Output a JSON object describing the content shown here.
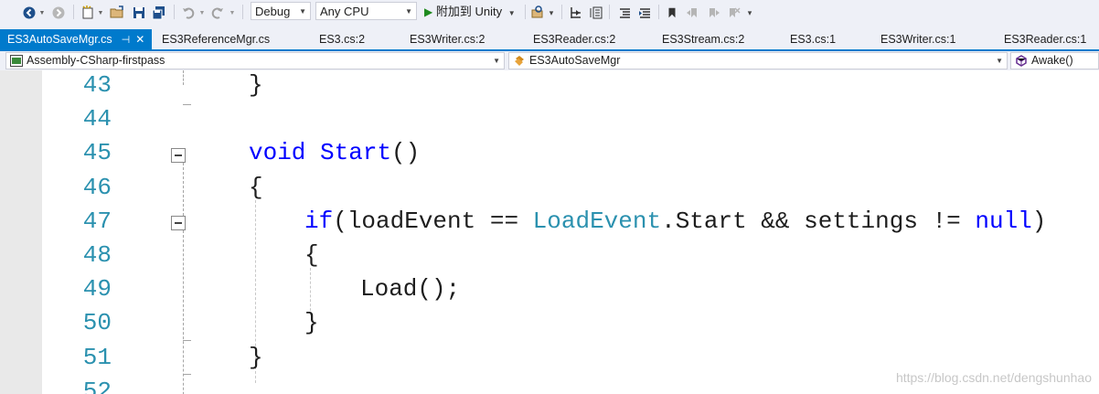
{
  "toolbar": {
    "config_label": "Debug",
    "platform_label": "Any CPU",
    "attach_label": "附加到 Unity"
  },
  "tabs": [
    {
      "label": "ES3AutoSaveMgr.cs",
      "active": true
    },
    {
      "label": "ES3ReferenceMgr.cs"
    },
    {
      "label": "ES3.cs:2"
    },
    {
      "label": "ES3Writer.cs:2"
    },
    {
      "label": "ES3Reader.cs:2"
    },
    {
      "label": "ES3Stream.cs:2"
    },
    {
      "label": "ES3.cs:1"
    },
    {
      "label": "ES3Writer.cs:1"
    },
    {
      "label": "ES3Reader.cs:1"
    }
  ],
  "nav": {
    "project": "Assembly-CSharp-firstpass",
    "type": "ES3AutoSaveMgr",
    "member": "Awake()"
  },
  "lines": [
    {
      "num": "43",
      "indent": 0,
      "parts": [
        {
          "t": "}",
          "c": ""
        }
      ]
    },
    {
      "num": "44",
      "indent": 0,
      "parts": []
    },
    {
      "num": "45",
      "indent": 0,
      "parts": [
        {
          "t": "void",
          "c": "kw"
        },
        {
          "t": " ",
          "c": ""
        },
        {
          "t": "Start",
          "c": "kw"
        },
        {
          "t": "()",
          "c": ""
        }
      ]
    },
    {
      "num": "46",
      "indent": 0,
      "parts": [
        {
          "t": "{",
          "c": ""
        }
      ]
    },
    {
      "num": "47",
      "indent": 1,
      "parts": [
        {
          "t": "if",
          "c": "kw"
        },
        {
          "t": "(loadEvent == ",
          "c": ""
        },
        {
          "t": "LoadEvent",
          "c": "ty"
        },
        {
          "t": ".Start && settings != ",
          "c": ""
        },
        {
          "t": "null",
          "c": "kw"
        },
        {
          "t": ")",
          "c": ""
        }
      ]
    },
    {
      "num": "48",
      "indent": 1,
      "parts": [
        {
          "t": "{",
          "c": ""
        }
      ]
    },
    {
      "num": "49",
      "indent": 2,
      "parts": [
        {
          "t": "Load();",
          "c": ""
        }
      ]
    },
    {
      "num": "50",
      "indent": 1,
      "parts": [
        {
          "t": "}",
          "c": ""
        }
      ]
    },
    {
      "num": "51",
      "indent": 0,
      "parts": [
        {
          "t": "}",
          "c": ""
        }
      ]
    },
    {
      "num": "52",
      "indent": 0,
      "parts": []
    }
  ],
  "watermark": "https://blog.csdn.net/dengshunhao",
  "colors": {
    "accent": "#007acc",
    "keyword": "#0000ff",
    "type": "#2b91af",
    "line_number": "#2b91af"
  }
}
